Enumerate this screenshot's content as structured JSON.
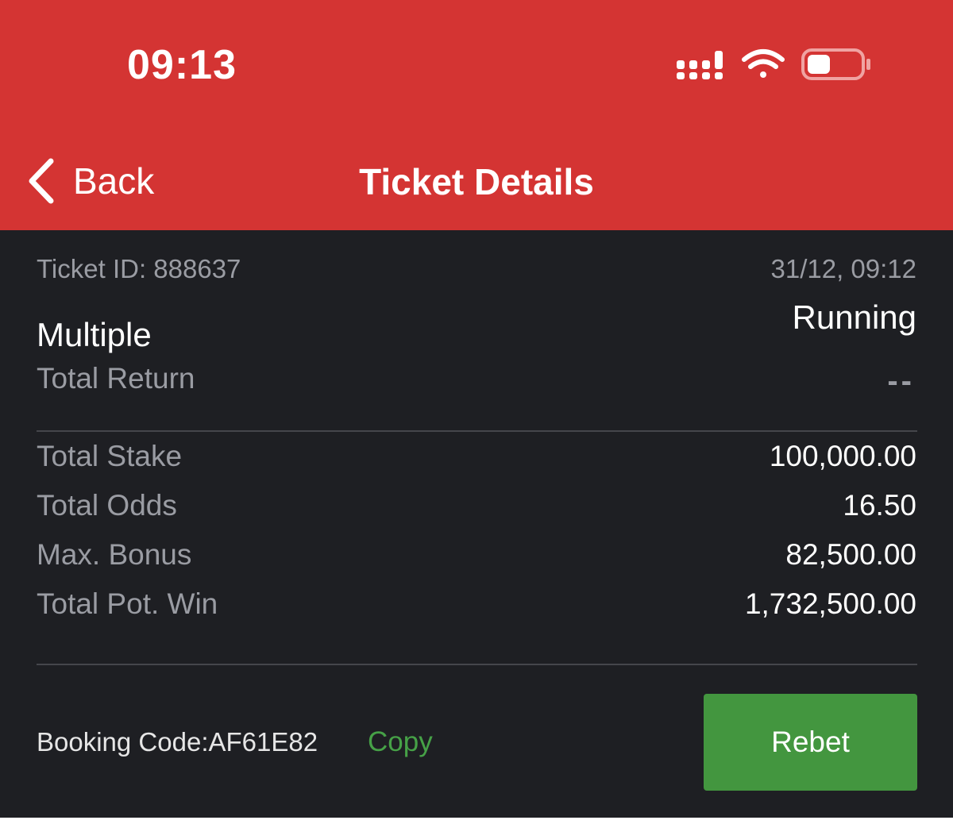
{
  "status_bar": {
    "time": "09:13",
    "icons": [
      "signal-icon",
      "wifi-icon",
      "battery-icon"
    ]
  },
  "header": {
    "back_label": "Back",
    "title": "Ticket Details"
  },
  "ticket": {
    "id_text": "Ticket ID: 888637",
    "datetime": "31/12, 09:12",
    "status": "Running",
    "bet_type": "Multiple",
    "total_return_label": "Total Return",
    "total_return_value": "--"
  },
  "summary": [
    {
      "label": "Total Stake",
      "value": "100,000.00"
    },
    {
      "label": "Total Odds",
      "value": "16.50"
    },
    {
      "label": "Max. Bonus",
      "value": "82,500.00"
    },
    {
      "label": "Total Pot. Win",
      "value": "1,732,500.00"
    }
  ],
  "footer": {
    "booking_code": "Booking Code:AF61E82",
    "copy_label": "Copy",
    "rebet_label": "Rebet"
  },
  "colors": {
    "header_bg": "#d43433",
    "content_bg": "#1e1f23",
    "accent_green": "#43963f",
    "copy_green": "#46a147",
    "muted_text": "#9a9ca3"
  }
}
